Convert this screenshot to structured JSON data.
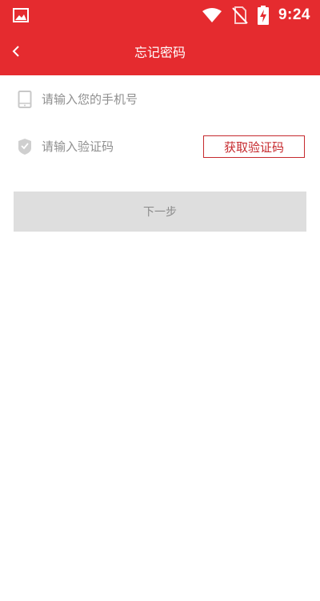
{
  "status_bar": {
    "time": "9:24",
    "icons": [
      "gallery-icon",
      "wifi-icon",
      "no-sim-icon",
      "battery-charging-icon"
    ]
  },
  "header": {
    "title": "忘记密码",
    "back_icon": "chevron-left-icon"
  },
  "form": {
    "phone_placeholder": "请输入您的手机号",
    "phone_icon": "phone-icon",
    "code_placeholder": "请输入验证码",
    "code_icon": "shield-check-icon",
    "get_code_label": "获取验证码",
    "next_label": "下一步"
  },
  "colors": {
    "brand_red": "#e52b2f",
    "button_border": "#c62a2e",
    "disabled_button": "#dedede"
  }
}
